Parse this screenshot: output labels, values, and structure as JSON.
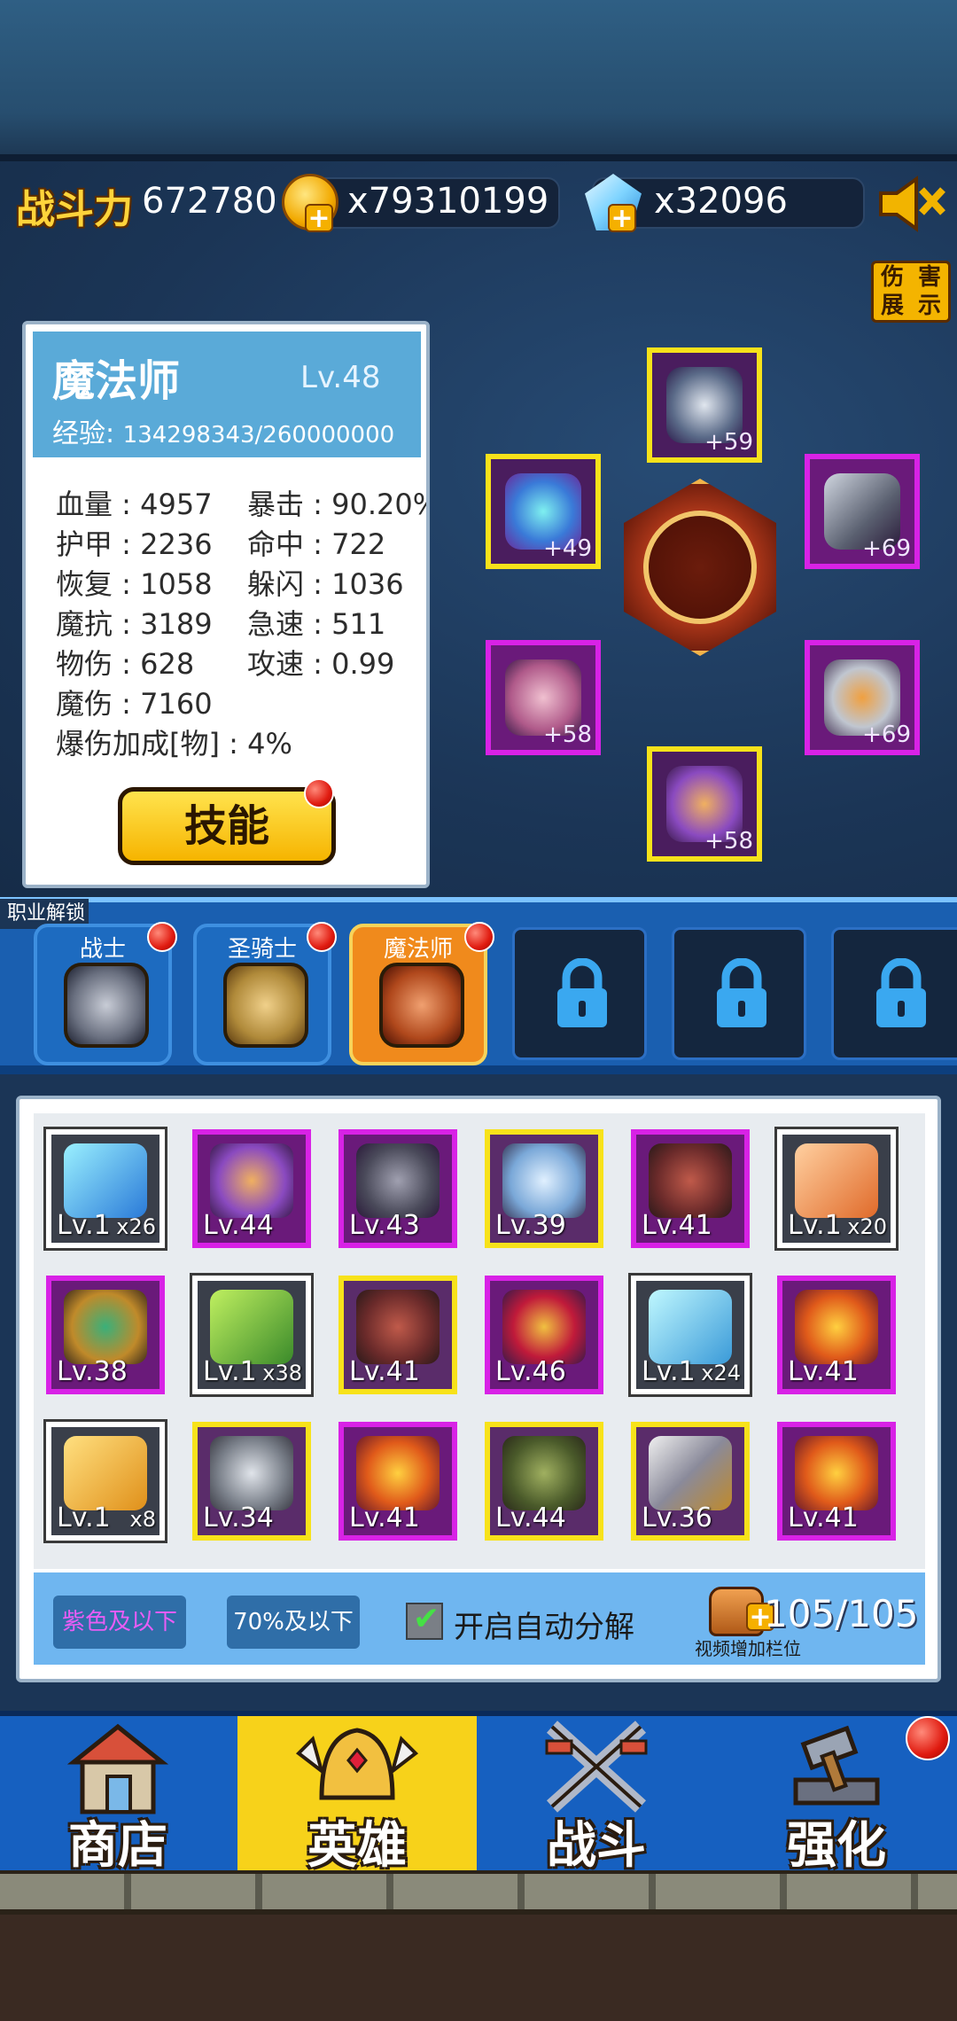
{
  "header": {
    "power_label": "战斗力",
    "power_value": "672780",
    "gold_value": "x79310199",
    "gem_value": "x32096",
    "sound_icon": "speaker-muted-icon",
    "damage_button": [
      "伤",
      "害",
      "展",
      "示"
    ]
  },
  "hero": {
    "class_name": "魔法师",
    "level": "Lv.48",
    "exp_label": "经验:",
    "exp_value": "134298343/260000000",
    "stats": [
      {
        "text": "血量 : 4957"
      },
      {
        "text": "暴击 : 90.20%"
      },
      {
        "text": "护甲 : 2236"
      },
      {
        "text": "命中 : 722"
      },
      {
        "text": "恢复 : 1058"
      },
      {
        "text": "躲闪 : 1036"
      },
      {
        "text": "魔抗 : 3189"
      },
      {
        "text": "急速 : 511"
      },
      {
        "text": "物伤 : 628"
      },
      {
        "text": "攻速 : 0.99"
      },
      {
        "text": "魔伤 : 7160"
      },
      {
        "text": "爆伤加成[物] : 4%"
      }
    ],
    "skill_button": "技能"
  },
  "equipment": [
    {
      "slot": "helmet",
      "plus": "+59",
      "rarity": "gold"
    },
    {
      "slot": "armor",
      "plus": "+49",
      "rarity": "gold"
    },
    {
      "slot": "weapon",
      "plus": "+69",
      "rarity": "purple"
    },
    {
      "slot": "amulet",
      "plus": "+58",
      "rarity": "purple"
    },
    {
      "slot": "ring",
      "plus": "+69",
      "rarity": "purple"
    },
    {
      "slot": "boots",
      "plus": "+58",
      "rarity": "gold"
    }
  ],
  "class_bar": {
    "unlock_label": "职业解锁",
    "classes": [
      {
        "name": "战士",
        "locked": false,
        "active": false
      },
      {
        "name": "圣骑士",
        "locked": false,
        "active": false
      },
      {
        "name": "魔法师",
        "locked": false,
        "active": true
      },
      {
        "locked": true
      },
      {
        "locked": true
      },
      {
        "locked": true
      }
    ]
  },
  "inventory": {
    "items": [
      {
        "lv": "Lv.1",
        "count": "x26",
        "rarity": "white"
      },
      {
        "lv": "Lv.44",
        "rarity": "purple"
      },
      {
        "lv": "Lv.43",
        "rarity": "purple"
      },
      {
        "lv": "Lv.39",
        "rarity": "gold"
      },
      {
        "lv": "Lv.41",
        "rarity": "purple"
      },
      {
        "lv": "Lv.1",
        "count": "x20",
        "rarity": "white"
      },
      {
        "lv": "Lv.38",
        "rarity": "purple"
      },
      {
        "lv": "Lv.1",
        "count": "x38",
        "rarity": "white"
      },
      {
        "lv": "Lv.41",
        "rarity": "gold"
      },
      {
        "lv": "Lv.46",
        "rarity": "purple"
      },
      {
        "lv": "Lv.1",
        "count": "x24",
        "rarity": "white"
      },
      {
        "lv": "Lv.41",
        "rarity": "purple"
      },
      {
        "lv": "Lv.1",
        "count": "x8",
        "rarity": "white"
      },
      {
        "lv": "Lv.34",
        "rarity": "gold"
      },
      {
        "lv": "Lv.41",
        "rarity": "purple"
      },
      {
        "lv": "Lv.44",
        "rarity": "gold"
      },
      {
        "lv": "Lv.36",
        "rarity": "gold"
      },
      {
        "lv": "Lv.41",
        "rarity": "purple"
      }
    ],
    "filter_purple": "紫色及以下",
    "filter_percent": "70%及以下",
    "auto_decompose": "开启自动分解",
    "bag_count": "105/105",
    "bag_note": "视频增加栏位"
  },
  "nav": {
    "shop": "商店",
    "hero": "英雄",
    "battle": "战斗",
    "upgrade": "强化"
  },
  "colors": {
    "gold_border": "#f7e21a",
    "purple_border": "#d822e6",
    "accent_yellow": "#f7d21a",
    "nav_blue": "#1660c0"
  }
}
